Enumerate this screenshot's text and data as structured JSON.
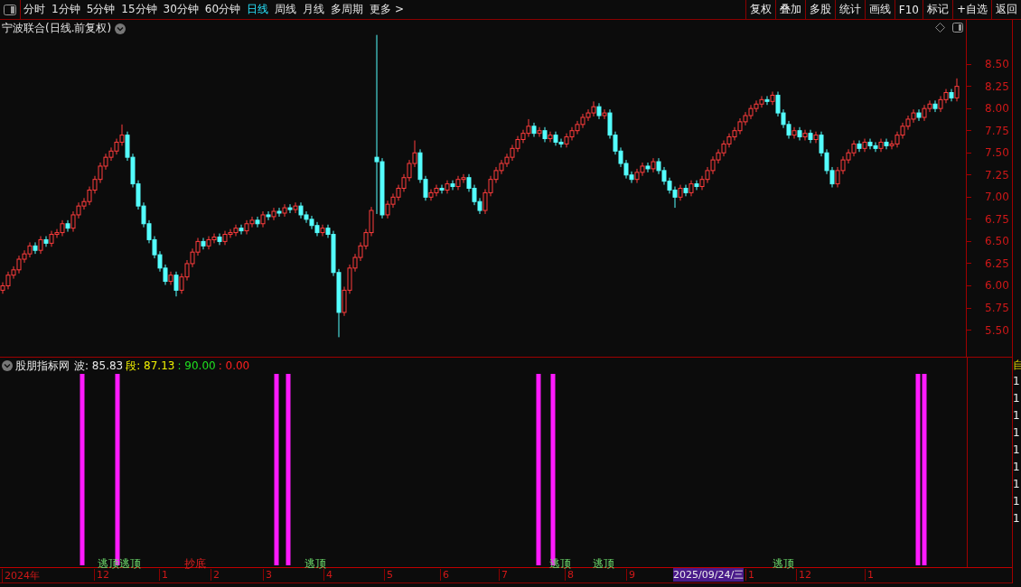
{
  "toolbar": {
    "periods": [
      {
        "label": "分时",
        "selected": false
      },
      {
        "label": "1分钟",
        "selected": false
      },
      {
        "label": "5分钟",
        "selected": false
      },
      {
        "label": "15分钟",
        "selected": false
      },
      {
        "label": "30分钟",
        "selected": false
      },
      {
        "label": "60分钟",
        "selected": false
      },
      {
        "label": "日线",
        "selected": true
      },
      {
        "label": "周线",
        "selected": false
      },
      {
        "label": "月线",
        "selected": false
      },
      {
        "label": "多周期",
        "selected": false
      },
      {
        "label": "更多 >",
        "selected": false
      }
    ],
    "buttons": [
      "复权",
      "叠加",
      "多股",
      "统计",
      "画线",
      "F10",
      "标记",
      "+自选",
      "返回"
    ]
  },
  "price_chart": {
    "title": "宁波联合(日线.前复权)",
    "chart_data": {
      "type": "candlestick",
      "ylim": [
        5.2,
        9.0
      ],
      "yticks": [
        {
          "value": 8.5,
          "label": "8.50"
        },
        {
          "value": 8.25,
          "label": "8.25"
        },
        {
          "value": 8.0,
          "label": "8.00"
        },
        {
          "value": 7.75,
          "label": "7.75"
        },
        {
          "value": 7.5,
          "label": "7.50"
        },
        {
          "value": 7.25,
          "label": "7.25"
        },
        {
          "value": 7.0,
          "label": "7.00"
        },
        {
          "value": 6.75,
          "label": "6.75"
        },
        {
          "value": 6.5,
          "label": "6.50"
        },
        {
          "value": 6.25,
          "label": "6.25"
        },
        {
          "value": 6.0,
          "label": "6.00"
        },
        {
          "value": 5.75,
          "label": "5.75"
        },
        {
          "value": 5.5,
          "label": "5.50"
        }
      ],
      "ohlc": [
        [
          5.95,
          6.04,
          5.91,
          6.0
        ],
        [
          6.0,
          6.16,
          5.96,
          6.12
        ],
        [
          6.12,
          6.22,
          6.08,
          6.18
        ],
        [
          6.18,
          6.34,
          6.14,
          6.3
        ],
        [
          6.3,
          6.4,
          6.26,
          6.36
        ],
        [
          6.36,
          6.49,
          6.32,
          6.45
        ],
        [
          6.45,
          6.49,
          6.36,
          6.4
        ],
        [
          6.4,
          6.56,
          6.36,
          6.52
        ],
        [
          6.52,
          6.56,
          6.44,
          6.48
        ],
        [
          6.48,
          6.62,
          6.44,
          6.58
        ],
        [
          6.58,
          6.64,
          6.54,
          6.6
        ],
        [
          6.6,
          6.74,
          6.56,
          6.7
        ],
        [
          6.7,
          6.74,
          6.61,
          6.65
        ],
        [
          6.65,
          6.84,
          6.61,
          6.8
        ],
        [
          6.8,
          6.94,
          6.76,
          6.9
        ],
        [
          6.9,
          6.99,
          6.86,
          6.95
        ],
        [
          6.95,
          7.12,
          6.91,
          7.08
        ],
        [
          7.08,
          7.24,
          7.04,
          7.2
        ],
        [
          7.2,
          7.39,
          7.16,
          7.35
        ],
        [
          7.35,
          7.49,
          7.31,
          7.45
        ],
        [
          7.45,
          7.56,
          7.41,
          7.52
        ],
        [
          7.52,
          7.66,
          7.48,
          7.62
        ],
        [
          7.62,
          7.82,
          7.58,
          7.7
        ],
        [
          7.7,
          7.74,
          7.41,
          7.45
        ],
        [
          7.45,
          7.49,
          7.11,
          7.15
        ],
        [
          7.15,
          7.19,
          6.86,
          6.9
        ],
        [
          6.9,
          6.94,
          6.66,
          6.7
        ],
        [
          6.7,
          6.74,
          6.48,
          6.52
        ],
        [
          6.52,
          6.56,
          6.31,
          6.35
        ],
        [
          6.35,
          6.39,
          6.16,
          6.2
        ],
        [
          6.2,
          6.24,
          6.01,
          6.05
        ],
        [
          6.05,
          6.16,
          6.01,
          6.12
        ],
        [
          6.12,
          6.16,
          5.88,
          5.95
        ],
        [
          5.95,
          6.14,
          5.91,
          6.1
        ],
        [
          6.1,
          6.29,
          6.06,
          6.25
        ],
        [
          6.25,
          6.42,
          6.21,
          6.38
        ],
        [
          6.38,
          6.54,
          6.34,
          6.5
        ],
        [
          6.5,
          6.54,
          6.41,
          6.45
        ],
        [
          6.45,
          6.56,
          6.41,
          6.52
        ],
        [
          6.52,
          6.59,
          6.48,
          6.55
        ],
        [
          6.55,
          6.59,
          6.46,
          6.5
        ],
        [
          6.5,
          6.62,
          6.46,
          6.58
        ],
        [
          6.58,
          6.64,
          6.54,
          6.6
        ],
        [
          6.6,
          6.69,
          6.56,
          6.65
        ],
        [
          6.65,
          6.69,
          6.58,
          6.62
        ],
        [
          6.62,
          6.74,
          6.58,
          6.7
        ],
        [
          6.7,
          6.78,
          6.66,
          6.74
        ],
        [
          6.74,
          6.78,
          6.66,
          6.7
        ],
        [
          6.7,
          6.84,
          6.66,
          6.8
        ],
        [
          6.8,
          6.84,
          6.74,
          6.78
        ],
        [
          6.78,
          6.88,
          6.74,
          6.84
        ],
        [
          6.84,
          6.88,
          6.78,
          6.82
        ],
        [
          6.82,
          6.92,
          6.78,
          6.88
        ],
        [
          6.88,
          6.92,
          6.82,
          6.86
        ],
        [
          6.86,
          6.94,
          6.82,
          6.9
        ],
        [
          6.9,
          6.94,
          6.76,
          6.8
        ],
        [
          6.8,
          6.84,
          6.71,
          6.75
        ],
        [
          6.75,
          6.79,
          6.64,
          6.68
        ],
        [
          6.68,
          6.72,
          6.56,
          6.6
        ],
        [
          6.6,
          6.69,
          6.56,
          6.65
        ],
        [
          6.65,
          6.69,
          6.54,
          6.58
        ],
        [
          6.58,
          6.62,
          6.11,
          6.15
        ],
        [
          6.15,
          6.19,
          5.42,
          5.7
        ],
        [
          5.7,
          5.99,
          5.66,
          5.95
        ],
        [
          5.95,
          6.24,
          5.91,
          6.2
        ],
        [
          6.2,
          6.36,
          6.16,
          6.32
        ],
        [
          6.32,
          6.49,
          6.28,
          6.45
        ],
        [
          6.45,
          6.64,
          6.41,
          6.6
        ],
        [
          6.6,
          6.89,
          6.56,
          6.85
        ],
        [
          7.45,
          8.83,
          6.81,
          7.4
        ],
        [
          7.4,
          7.44,
          6.76,
          6.8
        ],
        [
          6.8,
          6.96,
          6.76,
          6.92
        ],
        [
          6.92,
          7.04,
          6.88,
          7.0
        ],
        [
          7.0,
          7.14,
          6.96,
          7.1
        ],
        [
          7.1,
          7.26,
          7.06,
          7.22
        ],
        [
          7.22,
          7.42,
          7.18,
          7.38
        ],
        [
          7.38,
          7.64,
          7.34,
          7.5
        ],
        [
          7.5,
          7.54,
          7.16,
          7.2
        ],
        [
          7.2,
          7.24,
          6.96,
          7.0
        ],
        [
          7.0,
          7.09,
          6.96,
          7.05
        ],
        [
          7.05,
          7.14,
          7.01,
          7.1
        ],
        [
          7.1,
          7.14,
          7.04,
          7.08
        ],
        [
          7.08,
          7.19,
          7.04,
          7.15
        ],
        [
          7.15,
          7.19,
          7.08,
          7.12
        ],
        [
          7.12,
          7.24,
          7.08,
          7.2
        ],
        [
          7.2,
          7.26,
          7.16,
          7.22
        ],
        [
          7.22,
          7.26,
          7.06,
          7.1
        ],
        [
          7.1,
          7.14,
          6.91,
          6.95
        ],
        [
          6.95,
          6.99,
          6.81,
          6.85
        ],
        [
          6.85,
          7.09,
          6.81,
          7.05
        ],
        [
          7.05,
          7.24,
          7.01,
          7.2
        ],
        [
          7.2,
          7.34,
          7.16,
          7.3
        ],
        [
          7.3,
          7.42,
          7.26,
          7.38
        ],
        [
          7.38,
          7.49,
          7.34,
          7.45
        ],
        [
          7.45,
          7.59,
          7.41,
          7.55
        ],
        [
          7.55,
          7.69,
          7.51,
          7.65
        ],
        [
          7.65,
          7.76,
          7.61,
          7.72
        ],
        [
          7.72,
          7.88,
          7.68,
          7.8
        ],
        [
          7.8,
          7.84,
          7.68,
          7.72
        ],
        [
          7.72,
          7.79,
          7.68,
          7.75
        ],
        [
          7.75,
          7.79,
          7.62,
          7.66
        ],
        [
          7.66,
          7.74,
          7.62,
          7.7
        ],
        [
          7.7,
          7.74,
          7.58,
          7.62
        ],
        [
          7.62,
          7.66,
          7.56,
          7.6
        ],
        [
          7.6,
          7.72,
          7.56,
          7.68
        ],
        [
          7.68,
          7.79,
          7.64,
          7.75
        ],
        [
          7.75,
          7.86,
          7.71,
          7.82
        ],
        [
          7.82,
          7.94,
          7.78,
          7.9
        ],
        [
          7.9,
          7.99,
          7.86,
          7.95
        ],
        [
          7.95,
          8.08,
          7.91,
          8.02
        ],
        [
          8.02,
          8.06,
          7.88,
          7.92
        ],
        [
          7.92,
          7.99,
          7.88,
          7.95
        ],
        [
          7.95,
          7.99,
          7.66,
          7.7
        ],
        [
          7.7,
          7.74,
          7.48,
          7.52
        ],
        [
          7.52,
          7.56,
          7.34,
          7.38
        ],
        [
          7.38,
          7.42,
          7.21,
          7.25
        ],
        [
          7.25,
          7.29,
          7.16,
          7.2
        ],
        [
          7.2,
          7.32,
          7.16,
          7.28
        ],
        [
          7.28,
          7.39,
          7.24,
          7.35
        ],
        [
          7.35,
          7.39,
          7.28,
          7.32
        ],
        [
          7.32,
          7.44,
          7.28,
          7.4
        ],
        [
          7.4,
          7.44,
          7.26,
          7.3
        ],
        [
          7.3,
          7.34,
          7.14,
          7.18
        ],
        [
          7.18,
          7.22,
          7.04,
          7.08
        ],
        [
          7.08,
          7.12,
          6.88,
          7.0
        ],
        [
          7.0,
          7.14,
          6.96,
          7.1
        ],
        [
          7.1,
          7.14,
          7.01,
          7.05
        ],
        [
          7.05,
          7.19,
          7.01,
          7.15
        ],
        [
          7.15,
          7.19,
          7.08,
          7.12
        ],
        [
          7.12,
          7.24,
          7.08,
          7.2
        ],
        [
          7.2,
          7.34,
          7.16,
          7.3
        ],
        [
          7.3,
          7.46,
          7.26,
          7.42
        ],
        [
          7.42,
          7.54,
          7.38,
          7.5
        ],
        [
          7.5,
          7.64,
          7.46,
          7.6
        ],
        [
          7.6,
          7.72,
          7.56,
          7.68
        ],
        [
          7.68,
          7.79,
          7.64,
          7.75
        ],
        [
          7.75,
          7.89,
          7.71,
          7.85
        ],
        [
          7.85,
          7.96,
          7.81,
          7.92
        ],
        [
          7.92,
          8.04,
          7.88,
          8.0
        ],
        [
          8.0,
          8.09,
          7.96,
          8.05
        ],
        [
          8.05,
          8.14,
          8.01,
          8.1
        ],
        [
          8.1,
          8.14,
          8.04,
          8.08
        ],
        [
          8.08,
          8.19,
          8.04,
          8.15
        ],
        [
          8.15,
          8.19,
          7.91,
          7.95
        ],
        [
          7.95,
          7.99,
          7.78,
          7.82
        ],
        [
          7.82,
          7.86,
          7.66,
          7.7
        ],
        [
          7.7,
          7.79,
          7.66,
          7.75
        ],
        [
          7.75,
          7.79,
          7.64,
          7.68
        ],
        [
          7.68,
          7.76,
          7.64,
          7.72
        ],
        [
          7.72,
          7.76,
          7.61,
          7.65
        ],
        [
          7.65,
          7.74,
          7.61,
          7.7
        ],
        [
          7.7,
          7.74,
          7.46,
          7.5
        ],
        [
          7.5,
          7.54,
          7.26,
          7.3
        ],
        [
          7.3,
          7.34,
          7.11,
          7.15
        ],
        [
          7.15,
          7.34,
          7.11,
          7.3
        ],
        [
          7.3,
          7.46,
          7.26,
          7.42
        ],
        [
          7.42,
          7.54,
          7.38,
          7.5
        ],
        [
          7.5,
          7.64,
          7.46,
          7.6
        ],
        [
          7.6,
          7.64,
          7.51,
          7.55
        ],
        [
          7.55,
          7.66,
          7.51,
          7.62
        ],
        [
          7.62,
          7.66,
          7.54,
          7.58
        ],
        [
          7.58,
          7.62,
          7.51,
          7.55
        ],
        [
          7.55,
          7.66,
          7.51,
          7.62
        ],
        [
          7.62,
          7.66,
          7.54,
          7.58
        ],
        [
          7.58,
          7.64,
          7.54,
          7.6
        ],
        [
          7.6,
          7.74,
          7.56,
          7.7
        ],
        [
          7.7,
          7.84,
          7.66,
          7.8
        ],
        [
          7.8,
          7.92,
          7.76,
          7.88
        ],
        [
          7.88,
          7.99,
          7.84,
          7.95
        ],
        [
          7.95,
          7.99,
          7.86,
          7.9
        ],
        [
          7.9,
          8.04,
          7.86,
          8.0
        ],
        [
          8.0,
          8.09,
          7.96,
          8.05
        ],
        [
          8.05,
          8.09,
          7.96,
          8.0
        ],
        [
          8.0,
          8.14,
          7.96,
          8.1
        ],
        [
          8.1,
          8.22,
          8.06,
          8.18
        ],
        [
          8.18,
          8.22,
          8.08,
          8.12
        ],
        [
          8.12,
          8.34,
          8.08,
          8.25
        ]
      ]
    }
  },
  "indicator": {
    "name": "股朋指标网",
    "readings": [
      {
        "text": "波: 85.83",
        "color": "#e8e8e8"
      },
      {
        "text": "段: 87.13",
        "color": "#f0f000"
      },
      {
        "text": ": 90.00",
        "color": "#20e020"
      },
      {
        "text": ": 0.00",
        "color": "#ff2020"
      }
    ],
    "signals": [
      {
        "text": "逃顶",
        "kind": "sell"
      },
      {
        "text": "逃顶",
        "kind": "sell"
      },
      {
        "text": "抄底",
        "kind": "buy"
      },
      {
        "text": "逃顶",
        "kind": "sell"
      },
      {
        "text": "逃顶",
        "kind": "sell"
      },
      {
        "text": "逃顶",
        "kind": "sell"
      },
      {
        "text": "逃顶",
        "kind": "sell"
      }
    ]
  },
  "date_axis": {
    "labels": [
      "2024年",
      "12",
      "1",
      "2",
      "3",
      "4",
      "5",
      "6",
      "7",
      "8",
      "9",
      "1",
      "12",
      "1"
    ],
    "cursor_date": "2025/09/24/三"
  },
  "right_strip": {
    "header": "自",
    "values": [
      "1",
      "1",
      "1",
      "1",
      "1",
      "1",
      "1",
      "1",
      "1"
    ]
  }
}
